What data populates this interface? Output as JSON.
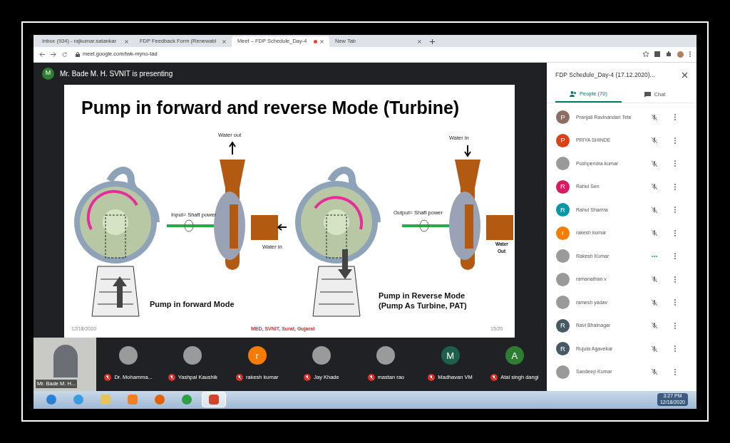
{
  "browser": {
    "tabs": [
      {
        "label": "Inbox (934) - rajkumar.satankar",
        "selected": false,
        "recording": false
      },
      {
        "label": "FDP Feedback Form (Renewabl",
        "selected": false,
        "recording": false
      },
      {
        "label": "Meet – FDP Schedule_Day-4",
        "selected": true,
        "recording": true
      },
      {
        "label": "New Tab",
        "selected": false,
        "recording": false
      }
    ],
    "address": "meet.google.com/twk-myno-tad"
  },
  "presenter_banner": {
    "initial": "M",
    "text": "Mr. Bade M. H. SVNIT is presenting"
  },
  "slide": {
    "title": "Pump in forward and reverse Mode (Turbine)",
    "labels": {
      "water_out_top": "Water out",
      "input_power": "Input= Shaft power",
      "water_in_side": "Water in",
      "forward_caption": "Pump in forward Mode",
      "water_in_top": "Water in",
      "output_power": "Output= Shaft power",
      "water_out_side_1": "Water",
      "water_out_side_2": "Out",
      "reverse_caption_1": "Pump in Reverse Mode",
      "reverse_caption_2": "(Pump As Turbine, PAT)"
    },
    "footer_date": "12/18/2020",
    "footer_center": "MED, SVNIT, Surat, Gujarat",
    "footer_page": "15/20"
  },
  "presenter_tile": {
    "name": "Mr. Bade M. H..."
  },
  "participants_strip": [
    {
      "name": "Dr. Mohamma...",
      "kind": "photo"
    },
    {
      "name": "Yashpal Kaushik",
      "kind": "photo"
    },
    {
      "name": "rakesh kumar",
      "kind": "letter",
      "initial": "r",
      "color": "#f57c00"
    },
    {
      "name": "Jay Khade",
      "kind": "photo"
    },
    {
      "name": "mastan rao",
      "kind": "photo"
    },
    {
      "name": "Madhavan VM",
      "kind": "letter",
      "initial": "M",
      "color": "#1e5f4a"
    },
    {
      "name": "Atal singh dangi",
      "kind": "letter",
      "initial": "A",
      "color": "#2e7d32"
    }
  ],
  "sidebar": {
    "title": "FDP Schedule_Day-4 (17.12.2020)...",
    "tabs": [
      {
        "label": "People (70)",
        "selected": true
      },
      {
        "label": "Chat",
        "selected": false
      }
    ],
    "people": [
      {
        "name": "Pranjali Ravinandan Tete",
        "kind": "letter",
        "initial": "P",
        "color": "#8d6e63",
        "muted": true
      },
      {
        "name": "PRIYA SHINDE",
        "kind": "letter",
        "initial": "P",
        "color": "#d84315",
        "muted": true
      },
      {
        "name": "Pushpendra kumar",
        "kind": "photo",
        "muted": true
      },
      {
        "name": "Rahul Sen",
        "kind": "letter",
        "initial": "R",
        "color": "#d81b60",
        "muted": true
      },
      {
        "name": "Rahul Sharma",
        "kind": "letter",
        "initial": "R",
        "color": "#0097a7",
        "muted": true
      },
      {
        "name": "rakesh kumar",
        "kind": "letter",
        "initial": "r",
        "color": "#f57c00",
        "muted": true
      },
      {
        "name": "Rakesh Kumar",
        "kind": "photo",
        "muted": false
      },
      {
        "name": "ramanathan v",
        "kind": "photo",
        "muted": true
      },
      {
        "name": "ramesh yadav",
        "kind": "photo",
        "muted": true
      },
      {
        "name": "Ravi Bhatnagar",
        "kind": "letter",
        "initial": "R",
        "color": "#455a64",
        "muted": true
      },
      {
        "name": "Rujuta Agavekar",
        "kind": "letter",
        "initial": "R",
        "color": "#455a64",
        "muted": true
      },
      {
        "name": "Sandeep Kumar",
        "kind": "photo",
        "muted": true
      }
    ]
  },
  "taskbar": {
    "apps": [
      {
        "selected": false
      },
      {
        "selected": false
      },
      {
        "selected": false
      },
      {
        "selected": false
      },
      {
        "selected": false
      },
      {
        "selected": false
      },
      {
        "selected": true
      }
    ],
    "time": "3:27 PM",
    "date": "12/18/2020"
  }
}
